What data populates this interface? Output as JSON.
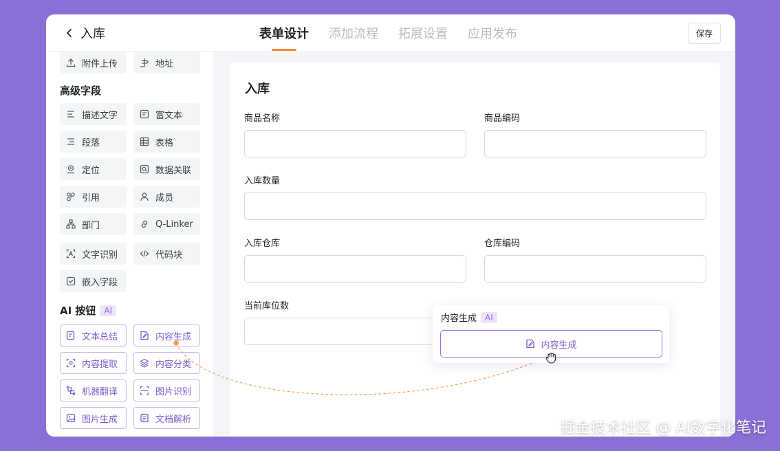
{
  "header": {
    "title": "入库",
    "tabs": [
      "表单设计",
      "添加流程",
      "拓展设置",
      "应用发布"
    ],
    "save_label": "保存"
  },
  "sidebar": {
    "basic_items": [
      {
        "label": "附件上传",
        "icon": "upload-icon"
      },
      {
        "label": "地址",
        "icon": "location-pin-icon"
      }
    ],
    "advanced_title": "高级字段",
    "advanced_items": [
      {
        "label": "描述文字",
        "icon": "text-lines-icon"
      },
      {
        "label": "富文本",
        "icon": "rich-text-icon"
      },
      {
        "label": "段落",
        "icon": "paragraph-icon"
      },
      {
        "label": "表格",
        "icon": "table-icon"
      },
      {
        "label": "定位",
        "icon": "location-icon"
      },
      {
        "label": "数据关联",
        "icon": "data-link-icon"
      },
      {
        "label": "引用",
        "icon": "reference-icon"
      },
      {
        "label": "成员",
        "icon": "user-icon"
      },
      {
        "label": "部门",
        "icon": "org-icon"
      },
      {
        "label": "Q-Linker",
        "icon": "link-icon"
      },
      {
        "label": "文字识别",
        "icon": "ocr-icon"
      },
      {
        "label": "代码块",
        "icon": "code-icon"
      },
      {
        "label": "嵌入字段",
        "icon": "embed-icon"
      }
    ],
    "ai_title": "AI 按钮",
    "ai_badge": "AI",
    "ai_items": [
      {
        "label": "文本总结",
        "icon": "summary-icon"
      },
      {
        "label": "内容生成",
        "icon": "content-generate-icon"
      },
      {
        "label": "内容提取",
        "icon": "extract-icon"
      },
      {
        "label": "内容分类",
        "icon": "layers-icon"
      },
      {
        "label": "机器翻译",
        "icon": "translate-icon"
      },
      {
        "label": "图片识别",
        "icon": "image-scan-icon"
      },
      {
        "label": "图片生成",
        "icon": "image-generate-icon"
      },
      {
        "label": "文档解析",
        "icon": "document-parse-icon"
      }
    ]
  },
  "form": {
    "title": "入库",
    "fields": [
      {
        "label": "商品名称",
        "value": ""
      },
      {
        "label": "商品编码",
        "value": ""
      },
      {
        "label": "入库数量",
        "value": ""
      },
      {
        "label": "入库仓库",
        "value": ""
      },
      {
        "label": "仓库编码",
        "value": ""
      },
      {
        "label": "当前库位数",
        "value": ""
      }
    ]
  },
  "popup": {
    "label": "内容生成",
    "badge": "AI",
    "button_label": "内容生成"
  },
  "watermark": "掘金技术社区 @ AI数字化笔记",
  "colors": {
    "background": "#8a6fd6",
    "accent_tab": "#f28a33",
    "ai_purple": "#7c5ccd",
    "ai_border": "#c9b6ee",
    "drag_path": "#f2a45a"
  }
}
